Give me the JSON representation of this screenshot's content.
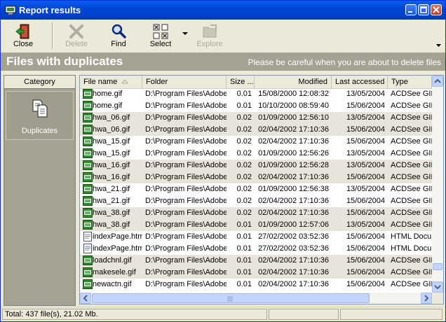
{
  "window": {
    "title": "Report results"
  },
  "toolbar": {
    "close_label": "Close",
    "delete_label": "Delete",
    "find_label": "Find",
    "select_label": "Select",
    "explore_label": "Explore"
  },
  "banner": {
    "title": "Files with duplicates",
    "warning": "Please be careful when you are about to delete files"
  },
  "category": {
    "header": "Category",
    "item_label": "Duplicates"
  },
  "table": {
    "columns": [
      "File name",
      "Folder",
      "Size ...",
      "Modified",
      "Last accessed",
      "Type"
    ],
    "rows": [
      {
        "name": "home.gif",
        "folder": "D:\\Program Files\\Adobe",
        "size": "0.01",
        "modified": "15/08/2000 12:08:32",
        "accessed": "13/05/2004",
        "type": "ACDSee GIF",
        "icon": "gif",
        "shade": false
      },
      {
        "name": "home.gif",
        "folder": "D:\\Program Files\\Adobe",
        "size": "0.01",
        "modified": "10/10/2000 08:59:40",
        "accessed": "15/06/2004",
        "type": "ACDSee GIF",
        "icon": "gif",
        "shade": false
      },
      {
        "name": "hwa_06.gif",
        "folder": "D:\\Program Files\\Adobe",
        "size": "0.02",
        "modified": "01/09/2000 12:56:10",
        "accessed": "13/05/2004",
        "type": "ACDSee GIF",
        "icon": "gif",
        "shade": true
      },
      {
        "name": "hwa_06.gif",
        "folder": "D:\\Program Files\\Adobe",
        "size": "0.02",
        "modified": "02/04/2002 17:10:36",
        "accessed": "15/06/2004",
        "type": "ACDSee GIF",
        "icon": "gif",
        "shade": true
      },
      {
        "name": "hwa_15.gif",
        "folder": "D:\\Program Files\\Adobe",
        "size": "0.02",
        "modified": "02/04/2002 17:10:36",
        "accessed": "15/06/2004",
        "type": "ACDSee GIF",
        "icon": "gif",
        "shade": false
      },
      {
        "name": "hwa_15.gif",
        "folder": "D:\\Program Files\\Adobe",
        "size": "0.02",
        "modified": "01/09/2000 12:56:26",
        "accessed": "13/05/2004",
        "type": "ACDSee GIF",
        "icon": "gif",
        "shade": false
      },
      {
        "name": "hwa_16.gif",
        "folder": "D:\\Program Files\\Adobe",
        "size": "0.02",
        "modified": "01/09/2000 12:56:28",
        "accessed": "13/05/2004",
        "type": "ACDSee GIF",
        "icon": "gif",
        "shade": true
      },
      {
        "name": "hwa_16.gif",
        "folder": "D:\\Program Files\\Adobe",
        "size": "0.02",
        "modified": "02/04/2002 17:10:36",
        "accessed": "15/06/2004",
        "type": "ACDSee GIF",
        "icon": "gif",
        "shade": true
      },
      {
        "name": "hwa_21.gif",
        "folder": "D:\\Program Files\\Adobe",
        "size": "0.02",
        "modified": "01/09/2000 12:56:38",
        "accessed": "13/05/2004",
        "type": "ACDSee GIF",
        "icon": "gif",
        "shade": false
      },
      {
        "name": "hwa_21.gif",
        "folder": "D:\\Program Files\\Adobe",
        "size": "0.02",
        "modified": "02/04/2002 17:10:36",
        "accessed": "15/06/2004",
        "type": "ACDSee GIF",
        "icon": "gif",
        "shade": false
      },
      {
        "name": "hwa_38.gif",
        "folder": "D:\\Program Files\\Adobe",
        "size": "0.02",
        "modified": "02/04/2002 17:10:36",
        "accessed": "15/06/2004",
        "type": "ACDSee GIF",
        "icon": "gif",
        "shade": true
      },
      {
        "name": "hwa_38.gif",
        "folder": "D:\\Program Files\\Adobe",
        "size": "0.01",
        "modified": "01/09/2000 12:57:06",
        "accessed": "13/05/2004",
        "type": "ACDSee GIF",
        "icon": "gif",
        "shade": true
      },
      {
        "name": "indexPage.htm",
        "folder": "D:\\Program Files\\Adobe",
        "size": "0.01",
        "modified": "27/02/2002 03:52:36",
        "accessed": "15/06/2004",
        "type": "HTML Docu",
        "icon": "html",
        "shade": false
      },
      {
        "name": "indexPage.htm",
        "folder": "D:\\Program Files\\Adobe",
        "size": "0.01",
        "modified": "27/02/2002 03:52:36",
        "accessed": "15/06/2004",
        "type": "HTML Docu",
        "icon": "html",
        "shade": false
      },
      {
        "name": "loadchnl.gif",
        "folder": "D:\\Program Files\\Adobe",
        "size": "0.01",
        "modified": "02/04/2002 17:10:36",
        "accessed": "15/06/2004",
        "type": "ACDSee GIF",
        "icon": "gif",
        "shade": true
      },
      {
        "name": "makesele.gif",
        "folder": "D:\\Program Files\\Adobe",
        "size": "0.01",
        "modified": "02/04/2002 17:10:36",
        "accessed": "15/06/2004",
        "type": "ACDSee GIF",
        "icon": "gif",
        "shade": true
      },
      {
        "name": "newactn.gif",
        "folder": "D:\\Program Files\\Adobe",
        "size": "0.01",
        "modified": "02/04/2002 17:10:36",
        "accessed": "15/06/2004",
        "type": "ACDSee GIF",
        "icon": "gif",
        "shade": false
      }
    ]
  },
  "status": {
    "summary": "Total: 437 file(s), 21.02 Mb."
  },
  "colors": {
    "titlebar": "#0046d5",
    "banner": "#a5a293",
    "row_shade": "#e8e4db",
    "gif_icon": "#2d8a2d"
  }
}
